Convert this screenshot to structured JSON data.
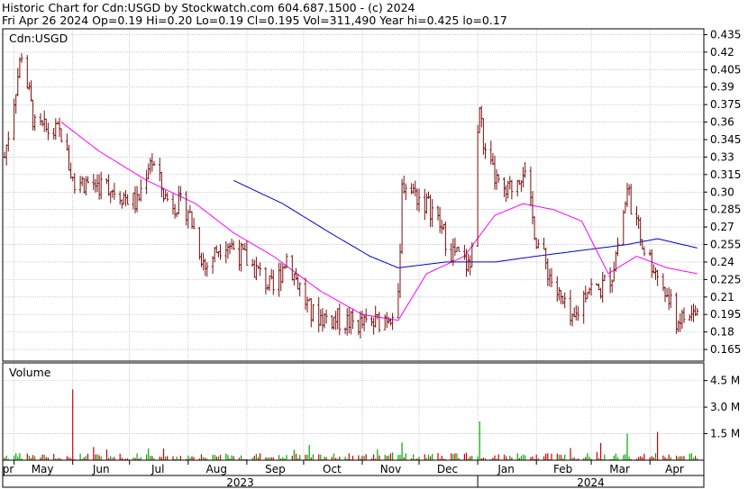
{
  "header": {
    "line1": "Historic Chart for Cdn:USGD by Stockwatch.com 604.687.1500 - (c) 2024",
    "line2": "Fri Apr 26 2024   Op=0.19  Hi=0.20  Lo=0.19  Cl=0.195  Vol=311,490  Year hi=0.425  lo=0.17"
  },
  "chart_data": {
    "type": "candlestick",
    "symbol_label": "Cdn:USGD",
    "volume_label": "Volume",
    "x_month_labels": [
      "pr",
      "May",
      "Jun",
      "Jul",
      "Aug",
      "Sep",
      "Oct",
      "Nov",
      "Dec",
      "Jan",
      "Feb",
      "Mar",
      "Apr"
    ],
    "x_year_labels": [
      "2023",
      "2024"
    ],
    "price_axis": {
      "ylim": [
        0.155,
        0.44
      ],
      "ticks": [
        "0.435",
        "0.42",
        "0.405",
        "0.39",
        "0.375",
        "0.36",
        "0.345",
        "0.33",
        "0.315",
        "0.30",
        "0.285",
        "0.27",
        "0.255",
        "0.24",
        "0.225",
        "0.21",
        "0.195",
        "0.18",
        "0.165"
      ]
    },
    "volume_axis": {
      "ylim": [
        0,
        5.5
      ],
      "ticks": [
        "4.5 M",
        "3.0 M",
        "1.5 M"
      ]
    },
    "price_keypoints": [
      {
        "date": "2023-04-26",
        "close": 0.33
      },
      {
        "date": "2023-05-05",
        "close": 0.42
      },
      {
        "date": "2023-05-12",
        "close": 0.355
      },
      {
        "date": "2023-05-26",
        "close": 0.35
      },
      {
        "date": "2023-06-01",
        "close": 0.31
      },
      {
        "date": "2023-06-20",
        "close": 0.305
      },
      {
        "date": "2023-07-05",
        "close": 0.29
      },
      {
        "date": "2023-07-12",
        "close": 0.33
      },
      {
        "date": "2023-07-20",
        "close": 0.295
      },
      {
        "date": "2023-08-01",
        "close": 0.285
      },
      {
        "date": "2023-08-10",
        "close": 0.235
      },
      {
        "date": "2023-08-20",
        "close": 0.26
      },
      {
        "date": "2023-09-05",
        "close": 0.235
      },
      {
        "date": "2023-09-15",
        "close": 0.215
      },
      {
        "date": "2023-09-22",
        "close": 0.245
      },
      {
        "date": "2023-10-05",
        "close": 0.195
      },
      {
        "date": "2023-10-20",
        "close": 0.19
      },
      {
        "date": "2023-11-05",
        "close": 0.185
      },
      {
        "date": "2023-11-15",
        "close": 0.195
      },
      {
        "date": "2023-11-20",
        "close": 0.205
      },
      {
        "date": "2023-11-22",
        "close": 0.31
      },
      {
        "date": "2023-11-28",
        "close": 0.3
      },
      {
        "date": "2023-12-08",
        "close": 0.285
      },
      {
        "date": "2023-12-18",
        "close": 0.25
      },
      {
        "date": "2023-12-28",
        "close": 0.235
      },
      {
        "date": "2024-01-02",
        "close": 0.37
      },
      {
        "date": "2024-01-05",
        "close": 0.33
      },
      {
        "date": "2024-01-15",
        "close": 0.295
      },
      {
        "date": "2024-01-25",
        "close": 0.32
      },
      {
        "date": "2024-02-01",
        "close": 0.26
      },
      {
        "date": "2024-02-10",
        "close": 0.22
      },
      {
        "date": "2024-02-20",
        "close": 0.185
      },
      {
        "date": "2024-02-28",
        "close": 0.22
      },
      {
        "date": "2024-03-05",
        "close": 0.215
      },
      {
        "date": "2024-03-12",
        "close": 0.23
      },
      {
        "date": "2024-03-20",
        "close": 0.3
      },
      {
        "date": "2024-03-28",
        "close": 0.255
      },
      {
        "date": "2024-04-05",
        "close": 0.23
      },
      {
        "date": "2024-04-15",
        "close": 0.19
      },
      {
        "date": "2024-04-26",
        "close": 0.195
      }
    ],
    "ma_short_keypoints": [
      {
        "date": "2023-05-26",
        "value": 0.36
      },
      {
        "date": "2023-06-15",
        "value": 0.335
      },
      {
        "date": "2023-07-10",
        "value": 0.31
      },
      {
        "date": "2023-08-05",
        "value": 0.29
      },
      {
        "date": "2023-08-25",
        "value": 0.265
      },
      {
        "date": "2023-09-15",
        "value": 0.245
      },
      {
        "date": "2023-10-10",
        "value": 0.215
      },
      {
        "date": "2023-11-01",
        "value": 0.195
      },
      {
        "date": "2023-11-20",
        "value": 0.19
      },
      {
        "date": "2023-12-05",
        "value": 0.23
      },
      {
        "date": "2023-12-25",
        "value": 0.245
      },
      {
        "date": "2024-01-10",
        "value": 0.28
      },
      {
        "date": "2024-01-25",
        "value": 0.29
      },
      {
        "date": "2024-02-10",
        "value": 0.285
      },
      {
        "date": "2024-02-25",
        "value": 0.275
      },
      {
        "date": "2024-03-10",
        "value": 0.23
      },
      {
        "date": "2024-03-25",
        "value": 0.245
      },
      {
        "date": "2024-04-10",
        "value": 0.235
      },
      {
        "date": "2024-04-26",
        "value": 0.23
      }
    ],
    "ma_long_keypoints": [
      {
        "date": "2023-08-25",
        "value": 0.31
      },
      {
        "date": "2023-09-20",
        "value": 0.29
      },
      {
        "date": "2023-10-15",
        "value": 0.265
      },
      {
        "date": "2023-11-05",
        "value": 0.245
      },
      {
        "date": "2023-11-20",
        "value": 0.235
      },
      {
        "date": "2023-12-15",
        "value": 0.24
      },
      {
        "date": "2024-01-10",
        "value": 0.24
      },
      {
        "date": "2024-02-01",
        "value": 0.245
      },
      {
        "date": "2024-02-25",
        "value": 0.25
      },
      {
        "date": "2024-03-20",
        "value": 0.255
      },
      {
        "date": "2024-04-05",
        "value": 0.26
      },
      {
        "date": "2024-04-26",
        "value": 0.252
      }
    ],
    "volume_spikes": [
      {
        "date": "2023-06-01",
        "value": 4.0
      },
      {
        "date": "2023-11-22",
        "value": 1.0
      },
      {
        "date": "2024-01-02",
        "value": 2.2
      },
      {
        "date": "2024-03-20",
        "value": 1.5
      },
      {
        "date": "2024-04-05",
        "value": 1.6
      }
    ],
    "colors": {
      "up": "#00aa00",
      "down": "#cc0000",
      "ma_short": "#ff00ff",
      "ma_long": "#0000cc",
      "grid": "#b0b0b0"
    }
  }
}
